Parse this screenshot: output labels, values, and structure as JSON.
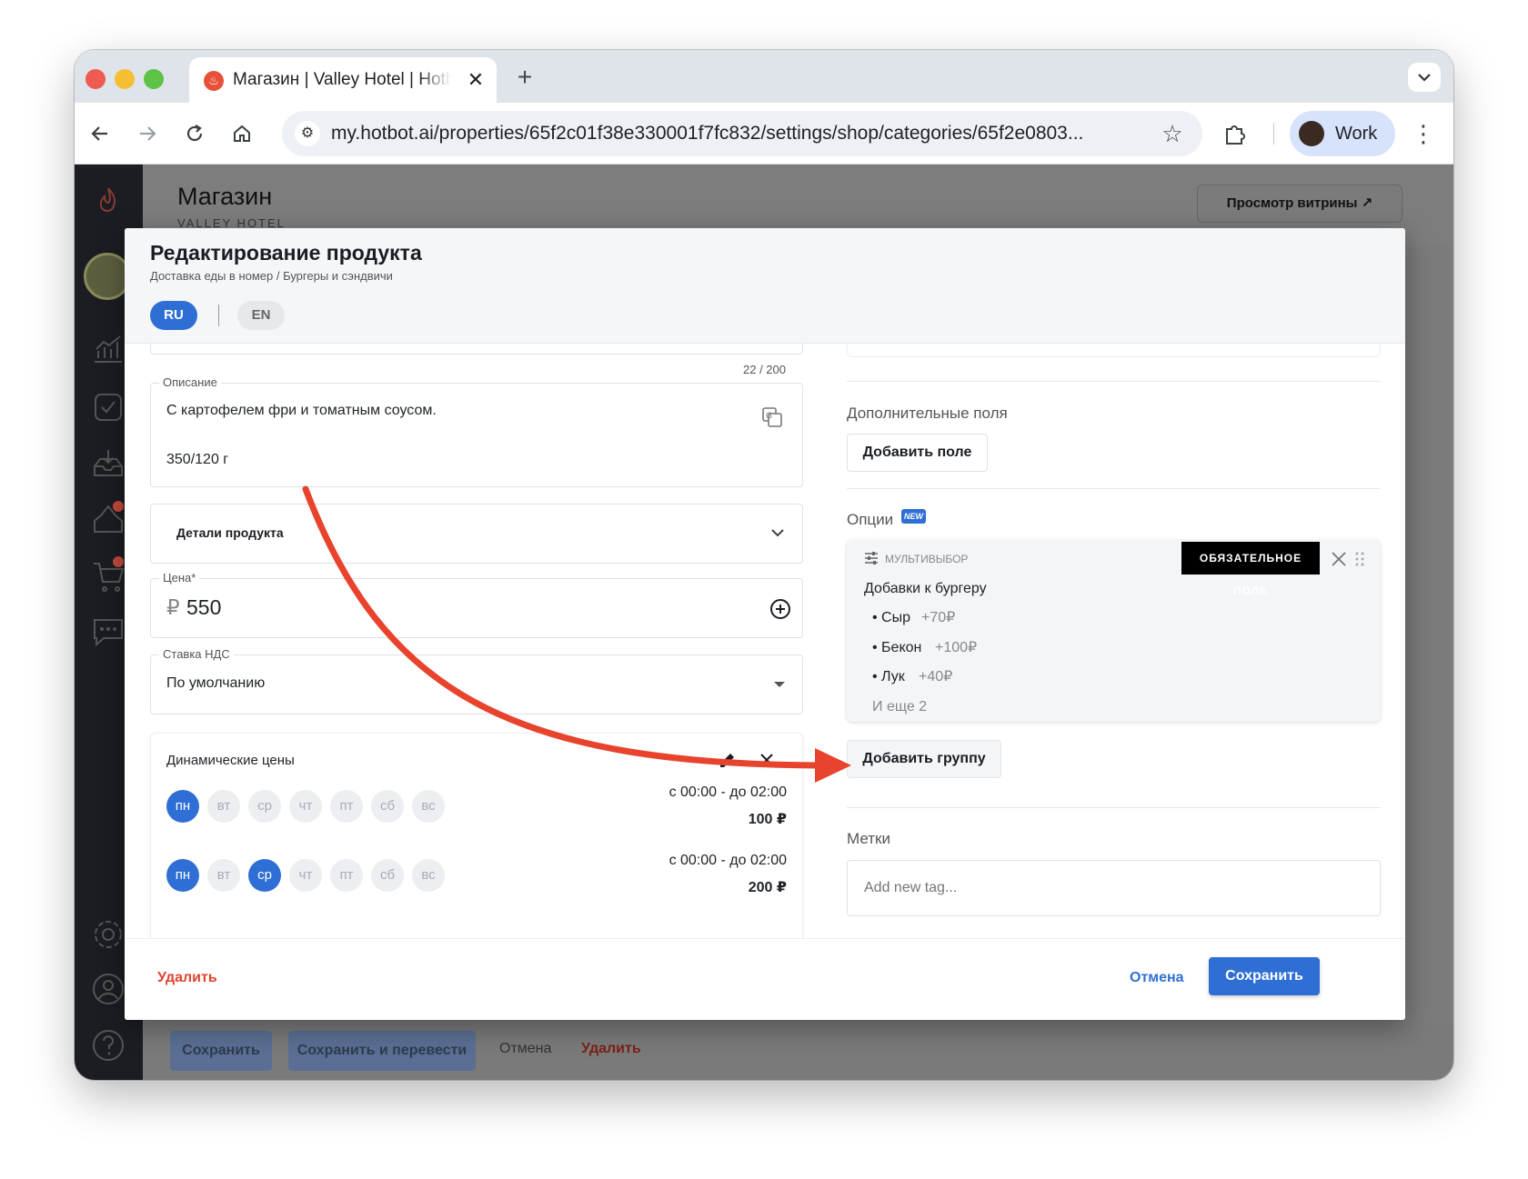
{
  "browser": {
    "tab_title": "Магазин | Valley Hotel | Hotbot",
    "url": "my.hotbot.ai/properties/65f2c01f38e330001f7fc832/settings/shop/categories/65f2e0803...",
    "profile_label": "Work",
    "new_tab_symbol": "+",
    "close_symbol": "✕"
  },
  "page": {
    "title": "Магазин",
    "subtitle": "VALLEY HOTEL",
    "storefront_button": "Просмотр витрины ↗",
    "bottom_actions": {
      "save": "Сохранить",
      "save_translate": "Сохранить и перевести",
      "cancel": "Отмена",
      "delete": "Удалить"
    }
  },
  "modal": {
    "title": "Редактирование продукта",
    "breadcrumb": "Доставка еды в номер / Бургеры и сэндвичи",
    "languages": [
      "RU",
      "EN"
    ],
    "left": {
      "char_counter": "22 / 200",
      "description": {
        "label": "Описание",
        "line1": "С картофелем фри и томатным соусом.",
        "line2": "350/120 г"
      },
      "details_label": "Детали продукта",
      "price": {
        "label": "Цена*",
        "currency": "₽",
        "value": "550"
      },
      "vat": {
        "label": "Ставка НДС",
        "value": "По умолчанию"
      },
      "dynamic_prices": {
        "title": "Динамические цены",
        "days": [
          "пн",
          "вт",
          "ср",
          "чт",
          "пт",
          "сб",
          "вс"
        ],
        "rules": [
          {
            "active_days": [
              0
            ],
            "time": "с 00:00 - до 02:00",
            "price": "100 ₽"
          },
          {
            "active_days": [
              0,
              2
            ],
            "time": "с 00:00 - до 02:00",
            "price": "200 ₽"
          }
        ]
      }
    },
    "right": {
      "extra_fields": {
        "title": "Дополнительные поля",
        "add_button": "Добавить поле"
      },
      "options": {
        "title": "Опции",
        "new_badge": "NEW",
        "group": {
          "type_label": "МУЛЬТИВЫБОР",
          "required_label": "ОБЯЗАТЕЛЬНОЕ ПОЛЕ",
          "name": "Добавки к бургеру",
          "items": [
            {
              "name": "• Сыр",
              "price": "+70₽"
            },
            {
              "name": "• Бекон",
              "price": "+100₽"
            },
            {
              "name": "• Лук",
              "price": "+40₽"
            }
          ],
          "more": "И еще 2"
        },
        "add_group_button": "Добавить группу"
      },
      "tags": {
        "title": "Метки",
        "placeholder": "Add new tag..."
      }
    },
    "footer": {
      "delete": "Удалить",
      "cancel": "Отмена",
      "save": "Сохранить"
    }
  },
  "colors": {
    "primary": "#2f6fd5",
    "danger": "#e0442f",
    "arrow": "#e8432c",
    "sidebar": "#1b1d22"
  }
}
